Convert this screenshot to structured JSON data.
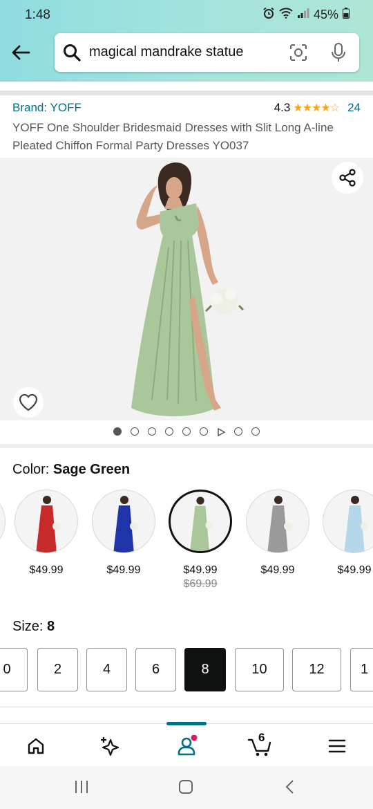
{
  "status": {
    "time": "1:48",
    "battery": "45%"
  },
  "search": {
    "query": "magical mandrake statue"
  },
  "product": {
    "brand": "Brand: YOFF",
    "rating": "4.3",
    "stars": "★★★★☆",
    "rating_count": "24",
    "title": "YOFF One Shoulder Bridesmaid Dresses with Slit Long A-line Pleated Chiffon Formal Party Dresses YO037",
    "image_count": 9,
    "active_image": 1
  },
  "color": {
    "label": "Color:",
    "selected": "Sage Green",
    "options": [
      {
        "color": "#c72a2a",
        "price": "$49.99",
        "strike": ""
      },
      {
        "color": "#1f34a8",
        "price": "$49.99",
        "strike": ""
      },
      {
        "color": "#a9c79b",
        "price": "$49.99",
        "strike": "$69.99"
      },
      {
        "color": "#9a9a9a",
        "price": "$49.99",
        "strike": ""
      },
      {
        "color": "#b4d7ea",
        "price": "$49.99",
        "strike": ""
      }
    ]
  },
  "size": {
    "label": "Size:",
    "selected": "8",
    "options": [
      "0",
      "2",
      "4",
      "6",
      "8",
      "10",
      "12",
      "1"
    ]
  },
  "nav": {
    "cart_count": "6"
  },
  "colors": {
    "accent": "#007185",
    "star": "#ffa41c",
    "dress": "#a9c79b",
    "badge": "#e2195b"
  }
}
